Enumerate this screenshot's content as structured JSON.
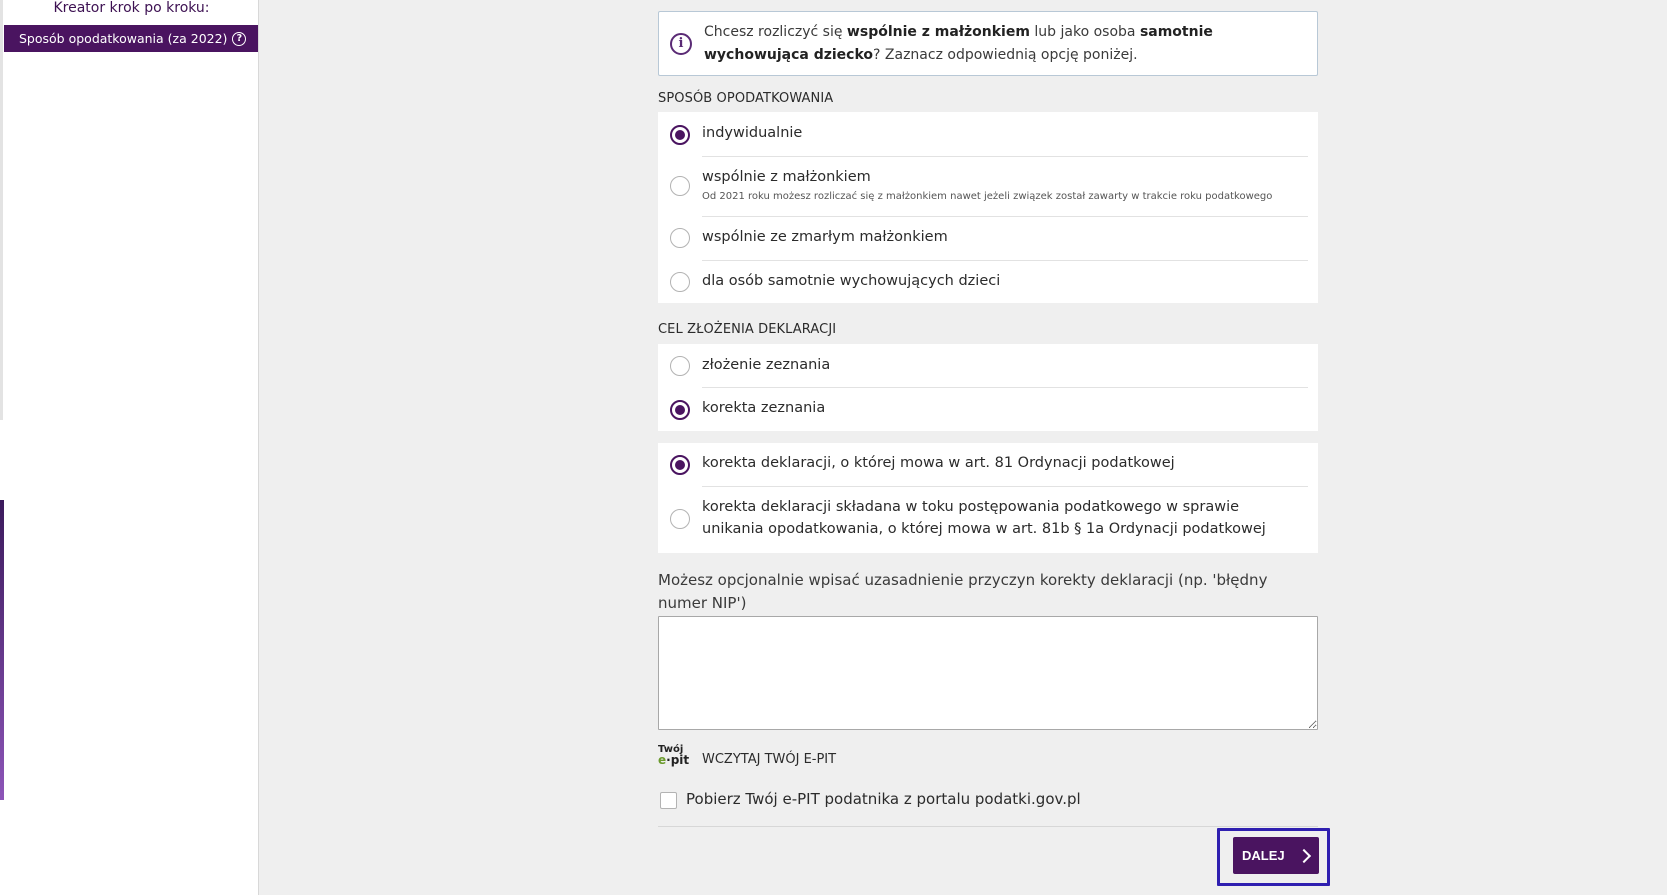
{
  "sidebar": {
    "title": "Kreator krok po kroku:",
    "active_item": "Sposób opodatkowania (za 2022)",
    "help_icon": "?"
  },
  "info": {
    "icon": "i",
    "text_part1": "Chcesz rozliczyć się ",
    "bold1": "wspólnie z małżonkiem",
    "text_part2": " lub jako osoba ",
    "bold2": "samotnie wychowująca dziecko",
    "text_part3": "? Zaznacz odpowiednią opcję poniżej."
  },
  "taxation": {
    "section_title": "SPOSÓB OPODATKOWANIA",
    "options": [
      {
        "label": "indywidualnie",
        "checked": true
      },
      {
        "label": "wspólnie z małżonkiem",
        "sub": "Od 2021 roku możesz rozliczać się z małżonkiem nawet jeżeli związek został zawarty w trakcie roku podatkowego",
        "checked": false
      },
      {
        "label": "wspólnie ze zmarłym małżonkiem",
        "checked": false
      },
      {
        "label": "dla osób samotnie wychowujących dzieci",
        "checked": false
      }
    ]
  },
  "purpose": {
    "section_title": "CEL ZŁOŻENIA DEKLARACJI",
    "options": [
      {
        "label": "złożenie zeznania",
        "checked": false
      },
      {
        "label": "korekta zeznania",
        "checked": true
      }
    ]
  },
  "correction": {
    "options": [
      {
        "label": "korekta deklaracji, o której mowa w art. 81 Ordynacji podatkowej",
        "checked": true
      },
      {
        "label": "korekta deklaracji składana w toku postępowania podatkowego w sprawie unikania opodatkowania, o której mowa w art. 81b § 1a Ordynacji podatkowej",
        "checked": false
      }
    ]
  },
  "justification": {
    "label": "Możesz opcjonalnie wpisać uzasadnienie przyczyn korekty deklaracji (np. 'błędny numer NIP')",
    "value": ""
  },
  "epit": {
    "logo_top": "Twój",
    "logo_e": "e",
    "logo_bottom": "pit",
    "title": "WCZYTAJ TWÓJ E-PIT",
    "checkbox_label": "Pobierz Twój e-PIT podatnika z portalu podatki.gov.pl",
    "checkbox_checked": false
  },
  "footer": {
    "next_label": "DALEJ"
  },
  "colors": {
    "accent": "#4a1460",
    "focus": "#2f1fb0"
  }
}
